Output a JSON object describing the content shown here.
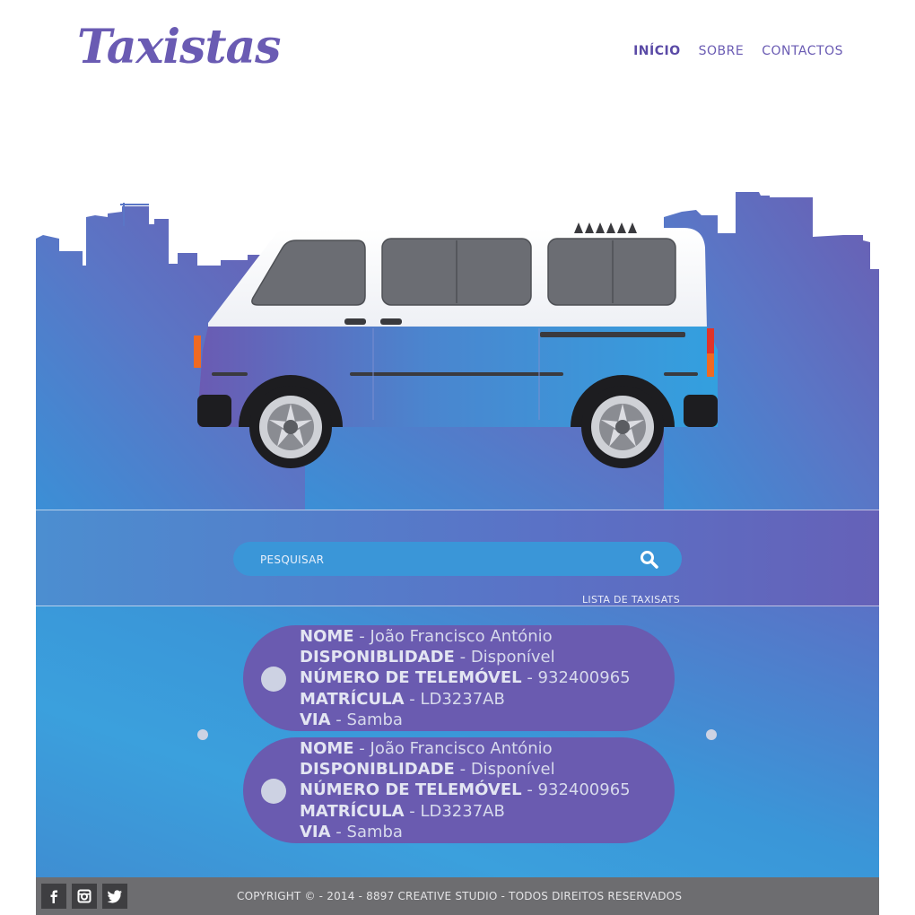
{
  "brand": {
    "logo_text": "Taxistas",
    "accent": "#6a5bb3"
  },
  "nav": {
    "items": [
      {
        "label": "INÍCIO",
        "active": true
      },
      {
        "label": "SOBRE",
        "active": false
      },
      {
        "label": "CONTACTOS",
        "active": false
      }
    ]
  },
  "search": {
    "placeholder": "PESQUISAR",
    "value": "",
    "icon": "search-icon"
  },
  "list_link": "LISTA DE TAXISATS",
  "results": [
    {
      "nome_label": "NOME",
      "nome": "João Francisco António",
      "disp_label": "DISPONIBLIDADE",
      "disp": "Disponível",
      "tel_label": "NÚMERO DE TELEMÓVEL",
      "tel": "932400965",
      "mat_label": "MATRÍCULA",
      "mat": "LD3237AB",
      "via_label": "VIA",
      "via": "Samba"
    },
    {
      "nome_label": "NOME",
      "nome": "João Francisco António",
      "disp_label": "DISPONIBLIDADE",
      "disp": "Disponível",
      "tel_label": "NÚMERO DE TELEMÓVEL",
      "tel": "932400965",
      "mat_label": "MATRÍCULA",
      "mat": "LD3237AB",
      "via_label": "VIA",
      "via": "Samba"
    }
  ],
  "separator": " - ",
  "footer": {
    "copyright": "COPYRIGHT © - 2014 - 8897 CREATIVE STUDIO - TODOS DIREITOS RESERVADOS",
    "social_icons": [
      "facebook-icon",
      "instagram-icon",
      "twitter-icon"
    ]
  },
  "colors": {
    "sky_blue": "#3a96d8",
    "purple": "#6a5bb0",
    "footer": "#6d6d70"
  }
}
